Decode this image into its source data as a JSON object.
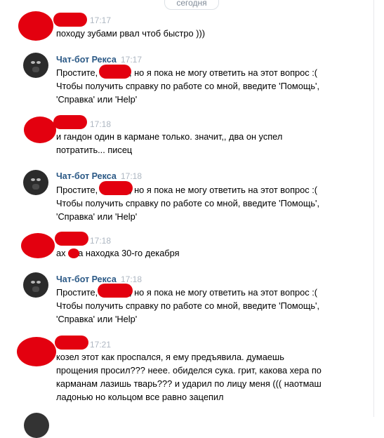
{
  "chat": {
    "date_label": "сегодня",
    "messages": [
      {
        "sender": "",
        "time": "17:17",
        "text": "походу зубами рвал чтоб быстро )))"
      },
      {
        "sender": "Чат-бот Рекса",
        "time": "17:17",
        "text_a": "Простите,",
        "text_b": ", но я пока не могу ответить на этот вопрос :(",
        "text_c": "Чтобы получить справку по работе со мной, введите 'Помощь',\n'Справка' или 'Help'"
      },
      {
        "sender": "",
        "time": "17:18",
        "text": "и гандон один в кармане только. значит,, два он успел\nпотратить... писец"
      },
      {
        "sender": "Чат-бот Рекса",
        "time": "17:18",
        "text_a": "Простите,",
        "text_b": ", но я пока не могу ответить на этот вопрос :(",
        "text_c": "Чтобы получить справку по работе со мной, введите 'Помощь',\n'Справка' или 'Help'"
      },
      {
        "sender": "",
        "time": "17:18",
        "text": "ах      нна находка 30-го декабря"
      },
      {
        "sender": "Чат-бот Рекса",
        "time": "17:18",
        "text_a": "Простите,",
        "text_b": ", но я пока не могу ответить на этот вопрос :(",
        "text_c": "Чтобы получить справку по работе со мной, введите 'Помощь',\n'Справка' или 'Help'"
      },
      {
        "sender": "",
        "time": "17:21",
        "text": "козел этот как проспался, я ему предъявила. думаешь\nпрощения просил??? нееe. обиделся сука. грит, какова хера по\nкарманам лазишь тварь??? и ударил по лицу меня ((( наотмаш\nладонью но кольцом все равно зацепил"
      }
    ]
  }
}
